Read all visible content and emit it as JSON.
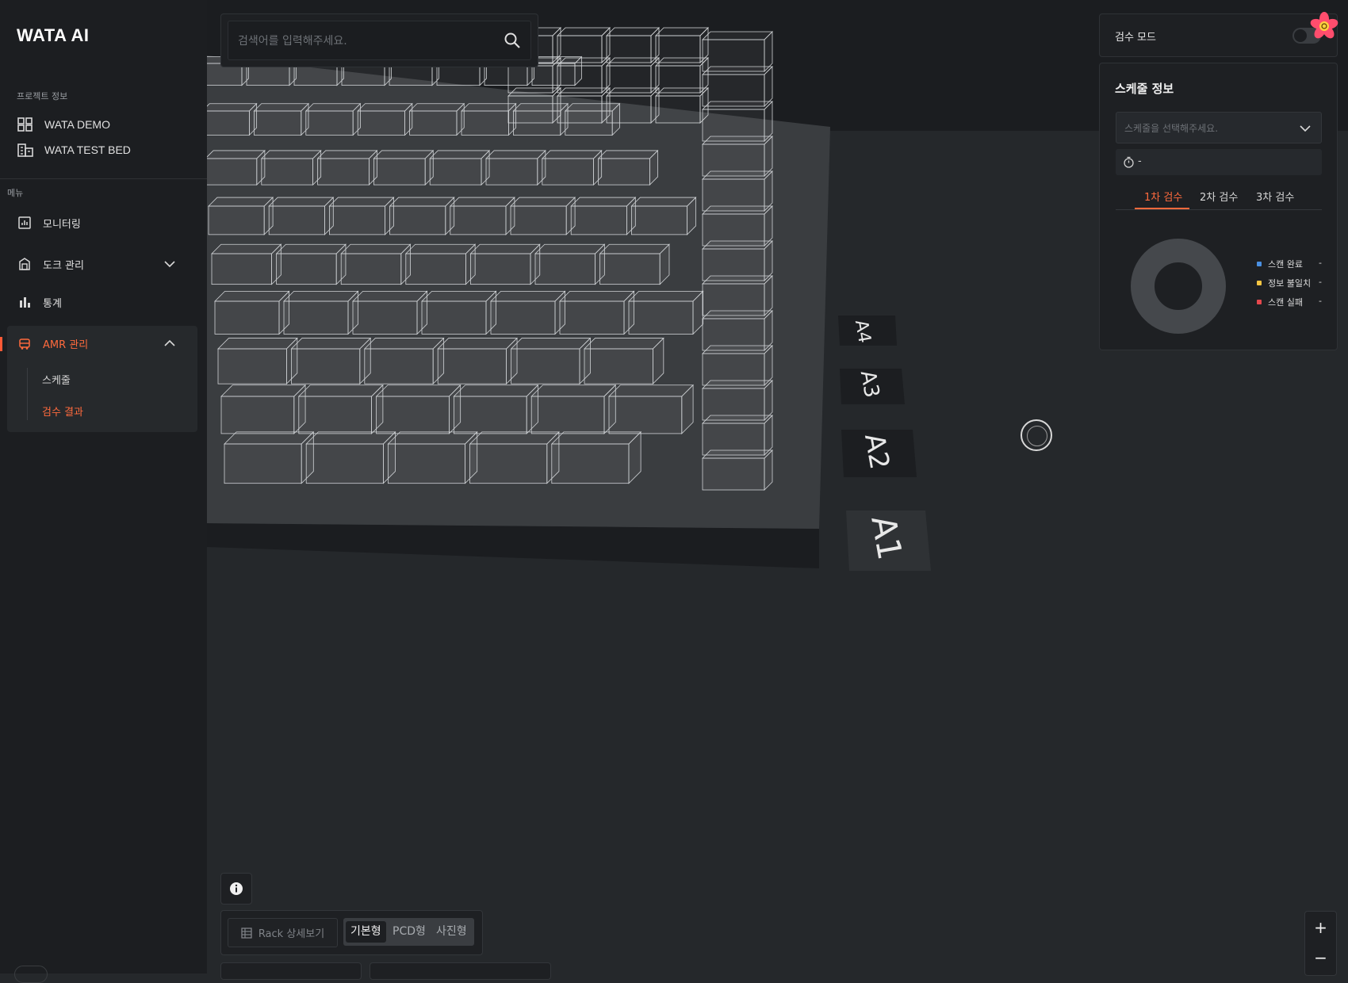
{
  "brand": {
    "logo": "WATA AI"
  },
  "sidebar": {
    "project_section": "프로젝트 정보",
    "projects": [
      {
        "label": "WATA DEMO",
        "icon": "grid-icon"
      },
      {
        "label": "WATA TEST BED",
        "icon": "building-icon"
      }
    ],
    "menu_section": "메뉴",
    "menu": [
      {
        "label": "모니터링",
        "icon": "monitor-chart-icon"
      },
      {
        "label": "도크 관리",
        "icon": "dock-icon",
        "expandable": true
      },
      {
        "label": "통계",
        "icon": "bar-chart-icon"
      },
      {
        "label": "AMR 관리",
        "icon": "robot-icon",
        "expanded": true,
        "active": true
      }
    ],
    "amr_submenu": [
      {
        "label": "스케줄",
        "active": false
      },
      {
        "label": "검수 결과",
        "active": true
      }
    ]
  },
  "search": {
    "placeholder": "검색어를 입력해주세요."
  },
  "inspection_mode": {
    "label": "검수 모드",
    "enabled": false
  },
  "schedule": {
    "title": "스케줄 정보",
    "select_placeholder": "스케줄을 선택해주세요.",
    "time_value": "-",
    "tabs": [
      {
        "label": "1차 검수",
        "active": true
      },
      {
        "label": "2차 검수",
        "active": false
      },
      {
        "label": "3차 검수",
        "active": false
      }
    ],
    "legend": [
      {
        "label": "스캔 완료",
        "value": "-",
        "color": "#4a90e2"
      },
      {
        "label": "정보 불일치",
        "value": "-",
        "color": "#f5c542"
      },
      {
        "label": "스캔 실패",
        "value": "-",
        "color": "#e5484d"
      }
    ]
  },
  "rack_labels": [
    "A4",
    "A3",
    "A2",
    "A1"
  ],
  "bottom_controls": {
    "rack_detail_label": "Rack 상세보기",
    "view_modes": [
      {
        "label": "기본형",
        "active": true
      },
      {
        "label": "PCD형",
        "active": false
      },
      {
        "label": "사진형",
        "active": false
      }
    ]
  },
  "zoom": {
    "in": "+",
    "out": "−"
  },
  "colors": {
    "accent": "#ff6a3d",
    "panel": "#1e2023",
    "sidebar": "#1c1e21",
    "canvas": "#25282b"
  }
}
